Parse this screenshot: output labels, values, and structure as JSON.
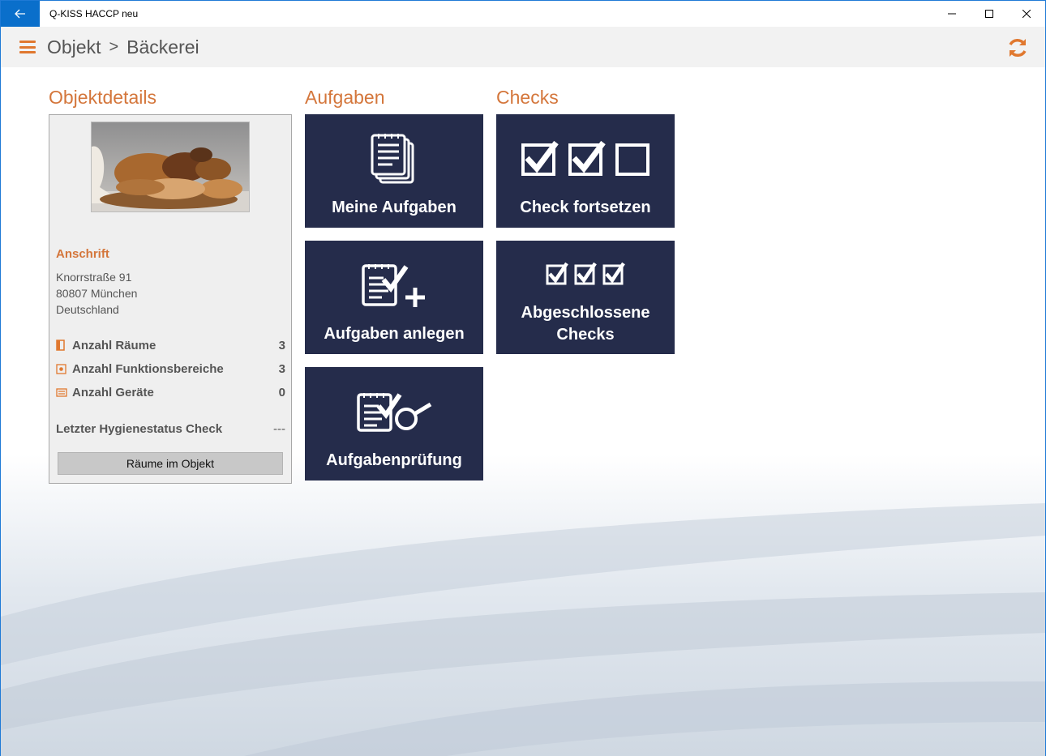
{
  "window": {
    "title": "Q-KISS HACCP neu"
  },
  "header": {
    "breadcrumb": [
      "Objekt",
      ">",
      "Bäckerei"
    ]
  },
  "details": {
    "title": "Objektdetails",
    "address_label": "Anschrift",
    "address": [
      "Knorrstraße 91",
      "80807 München",
      "Deutschland"
    ],
    "stats": [
      {
        "label": "Anzahl Räume",
        "value": "3",
        "icon": "door-icon"
      },
      {
        "label": "Anzahl Funktionsbereiche",
        "value": "3",
        "icon": "function-area-icon"
      },
      {
        "label": "Anzahl Geräte",
        "value": "0",
        "icon": "device-icon"
      }
    ],
    "last_check_label": "Letzter Hygienestatus Check",
    "last_check_value": "---",
    "rooms_button": "Räume im Objekt"
  },
  "aufgaben": {
    "title": "Aufgaben",
    "tiles": [
      {
        "label": "Meine Aufgaben",
        "icon": "task-list-icon"
      },
      {
        "label": "Aufgaben anlegen",
        "icon": "add-task-icon"
      },
      {
        "label": "Aufgabenprüfung",
        "icon": "task-review-icon"
      }
    ]
  },
  "checks": {
    "title": "Checks",
    "tiles": [
      {
        "label": "Check fortsetzen",
        "icon": "checkboxes-icon"
      },
      {
        "label": "Abgeschlossene Checks",
        "icon": "completed-checkboxes-icon"
      }
    ]
  },
  "colors": {
    "accent": "#d4763b",
    "tile": "#252c4b",
    "titlebar_back": "#0a6fcb"
  }
}
